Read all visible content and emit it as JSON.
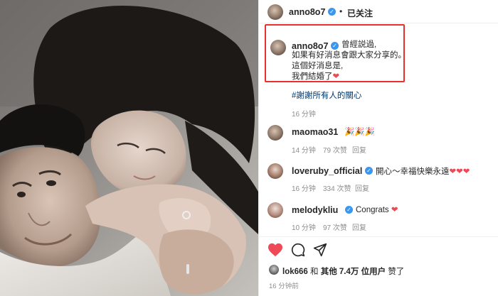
{
  "post": {
    "author": "anno8o7",
    "follow_status": "已关注",
    "caption_lines": [
      "曾經説過,",
      "如果有好消息會跟大家分享的。",
      "這個好消息是,",
      "我們結婚了"
    ],
    "hashtag": "#謝謝所有人的關心",
    "caption_time": "16 分钟"
  },
  "comments": [
    {
      "user": "maomao31",
      "text": "🎉🎉🎉",
      "time": "14 分钟",
      "likes": "79 次赞",
      "reply": "回复"
    },
    {
      "user": "loveruby_official",
      "text": "開心～幸福快樂永遠",
      "hearts": "❤❤❤",
      "time": "16 分钟",
      "likes": "334 次赞",
      "reply": "回复"
    },
    {
      "user": "melodykliu",
      "text": "Congrats",
      "heart": "❤",
      "time": "10 分钟",
      "likes": "97 次赞",
      "reply": "回复"
    }
  ],
  "footer": {
    "liked_by_user": "lok666",
    "liked_by_and": "和",
    "liked_by_others": "其他 7.4万 位用户",
    "liked_by_suffix": "赞了",
    "time_ago": "16 分钟前"
  },
  "icons": {
    "like": "heart-filled-icon",
    "comment": "comment-bubble-icon",
    "share": "paper-plane-icon",
    "verified": "verified-check-icon"
  },
  "colors": {
    "highlight_box": "#e8302c",
    "verified": "#3897f0",
    "like_red": "#ed4956",
    "hashtag": "#00376b",
    "meta_gray": "#8e8e8e"
  }
}
